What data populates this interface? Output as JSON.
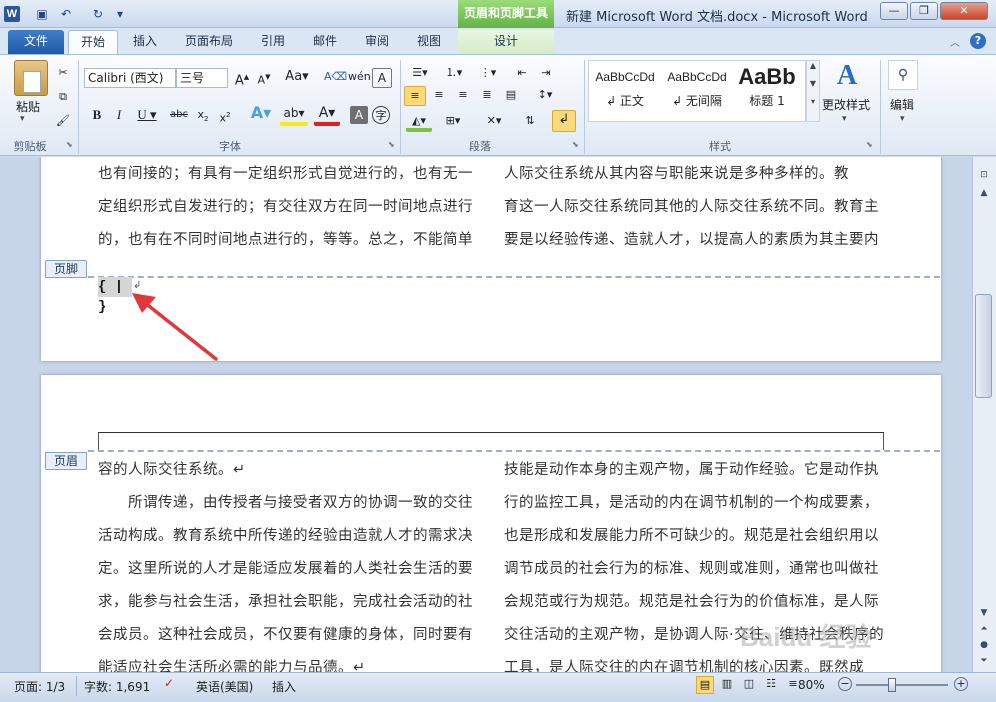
{
  "window": {
    "app_icon": "W",
    "context_tab": "页眉和页脚工具",
    "title": "新建 Microsoft Word 文档.docx - Microsoft Word",
    "controls": [
      "—",
      "❐",
      "✕"
    ]
  },
  "tabs": {
    "file": "文件",
    "items": [
      "开始",
      "插入",
      "页面布局",
      "引用",
      "邮件",
      "审阅",
      "视图"
    ],
    "design": "设计",
    "active": "开始"
  },
  "ribbon": {
    "clipboard": {
      "paste": "粘贴",
      "label": "剪贴板"
    },
    "font": {
      "name": "Calibri (西文)",
      "size": "三号",
      "label": "字体"
    },
    "paragraph": {
      "label": "段落"
    },
    "styles": {
      "items": [
        {
          "preview": "AaBbCcDd",
          "name": "↲ 正文"
        },
        {
          "preview": "AaBbCcDd",
          "name": "↲ 无间隔"
        },
        {
          "preview": "AaBb",
          "name": "标题 1"
        }
      ],
      "change": "更改样式",
      "label": "样式"
    },
    "editing": {
      "label": "编辑"
    }
  },
  "document": {
    "page1_left": [
      "也有间接的；有具有一定组织形式自觉进行的，也有无一",
      "定组织形式自发进行的；有交往双方在同一时间地点进行",
      "的，也有在不同时间地点进行的，等等。总之，不能简单"
    ],
    "page1_right": [
      "人际交往系统从其内容与职能来说是多种多样的。教",
      "育这一人际交往系统同其他的人际交往系统不同。教育主",
      "要是以经验传递、造就人才，以提高人的素质为其主要内"
    ],
    "footer_tag": "页脚",
    "footer_field": "{ | }",
    "header_tag": "页眉",
    "page2_left": [
      "容的人际交往系统。↵",
      "　　所谓传递，由传授者与接受者双方的协调一致的交往",
      "活动构成。教育系统中所传递的经验由造就人才的需求决",
      "定。这里所说的人才是能适应发展着的人类社会生活的要",
      "求，能参与社会生活，承担社会职能，完成社会活动的社",
      "会成员。这种社会成员，不仅要有健康的身体，同时要有",
      "能适应社会生活所必需的能力与品德。↵"
    ],
    "page2_right": [
      "技能是动作本身的主观产物，属于动作经验。它是动作执",
      "行的监控工具，是活动的内在调节机制的一个构成要素，",
      "也是形成和发展能力所不可缺少的。规范是社会组织用以",
      "调节成员的社会行为的标准、规则或准则，通常也叫做社",
      "会规范或行为规范。规范是社会行为的价值标准，是人际",
      "交往活动的主观产物，是协调人际·交往、维持社会秩序的",
      "工具，是人际交往的内在调节机制的核心因素。既然成"
    ]
  },
  "status": {
    "page": "页面: 1/3",
    "words": "字数: 1,691",
    "lang": "英语(美国)",
    "mode": "插入",
    "zoom": "80%",
    "zoom_level": 0.8
  },
  "watermark": "Baidu 经验",
  "colors": {
    "accent": "#2b579a",
    "context": "#63b245",
    "arrow": "#e0373c"
  }
}
